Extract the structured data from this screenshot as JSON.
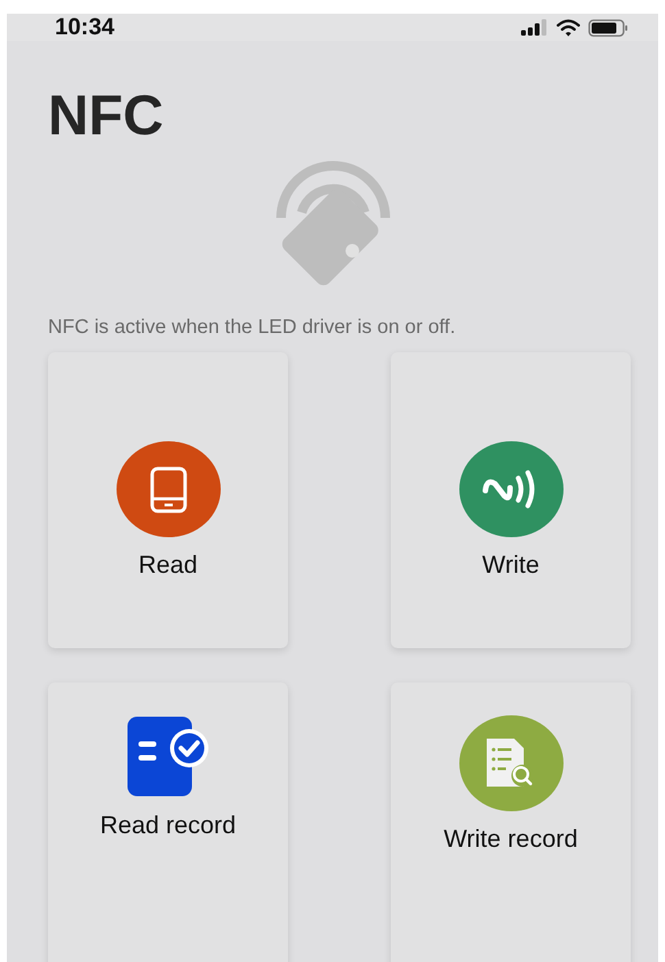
{
  "status_bar": {
    "time": "10:34"
  },
  "title": "NFC",
  "note": "NFC is active when the LED driver is on or off.",
  "actions": [
    {
      "kind": "read",
      "label": "Read",
      "color": "#cf4a12"
    },
    {
      "kind": "write",
      "label": "Write",
      "color": "#2f9161"
    },
    {
      "kind": "read_record",
      "label": "Read record",
      "color": "#0b46d6"
    },
    {
      "kind": "write_record",
      "label": "Write record",
      "color": "#8eab42"
    }
  ]
}
